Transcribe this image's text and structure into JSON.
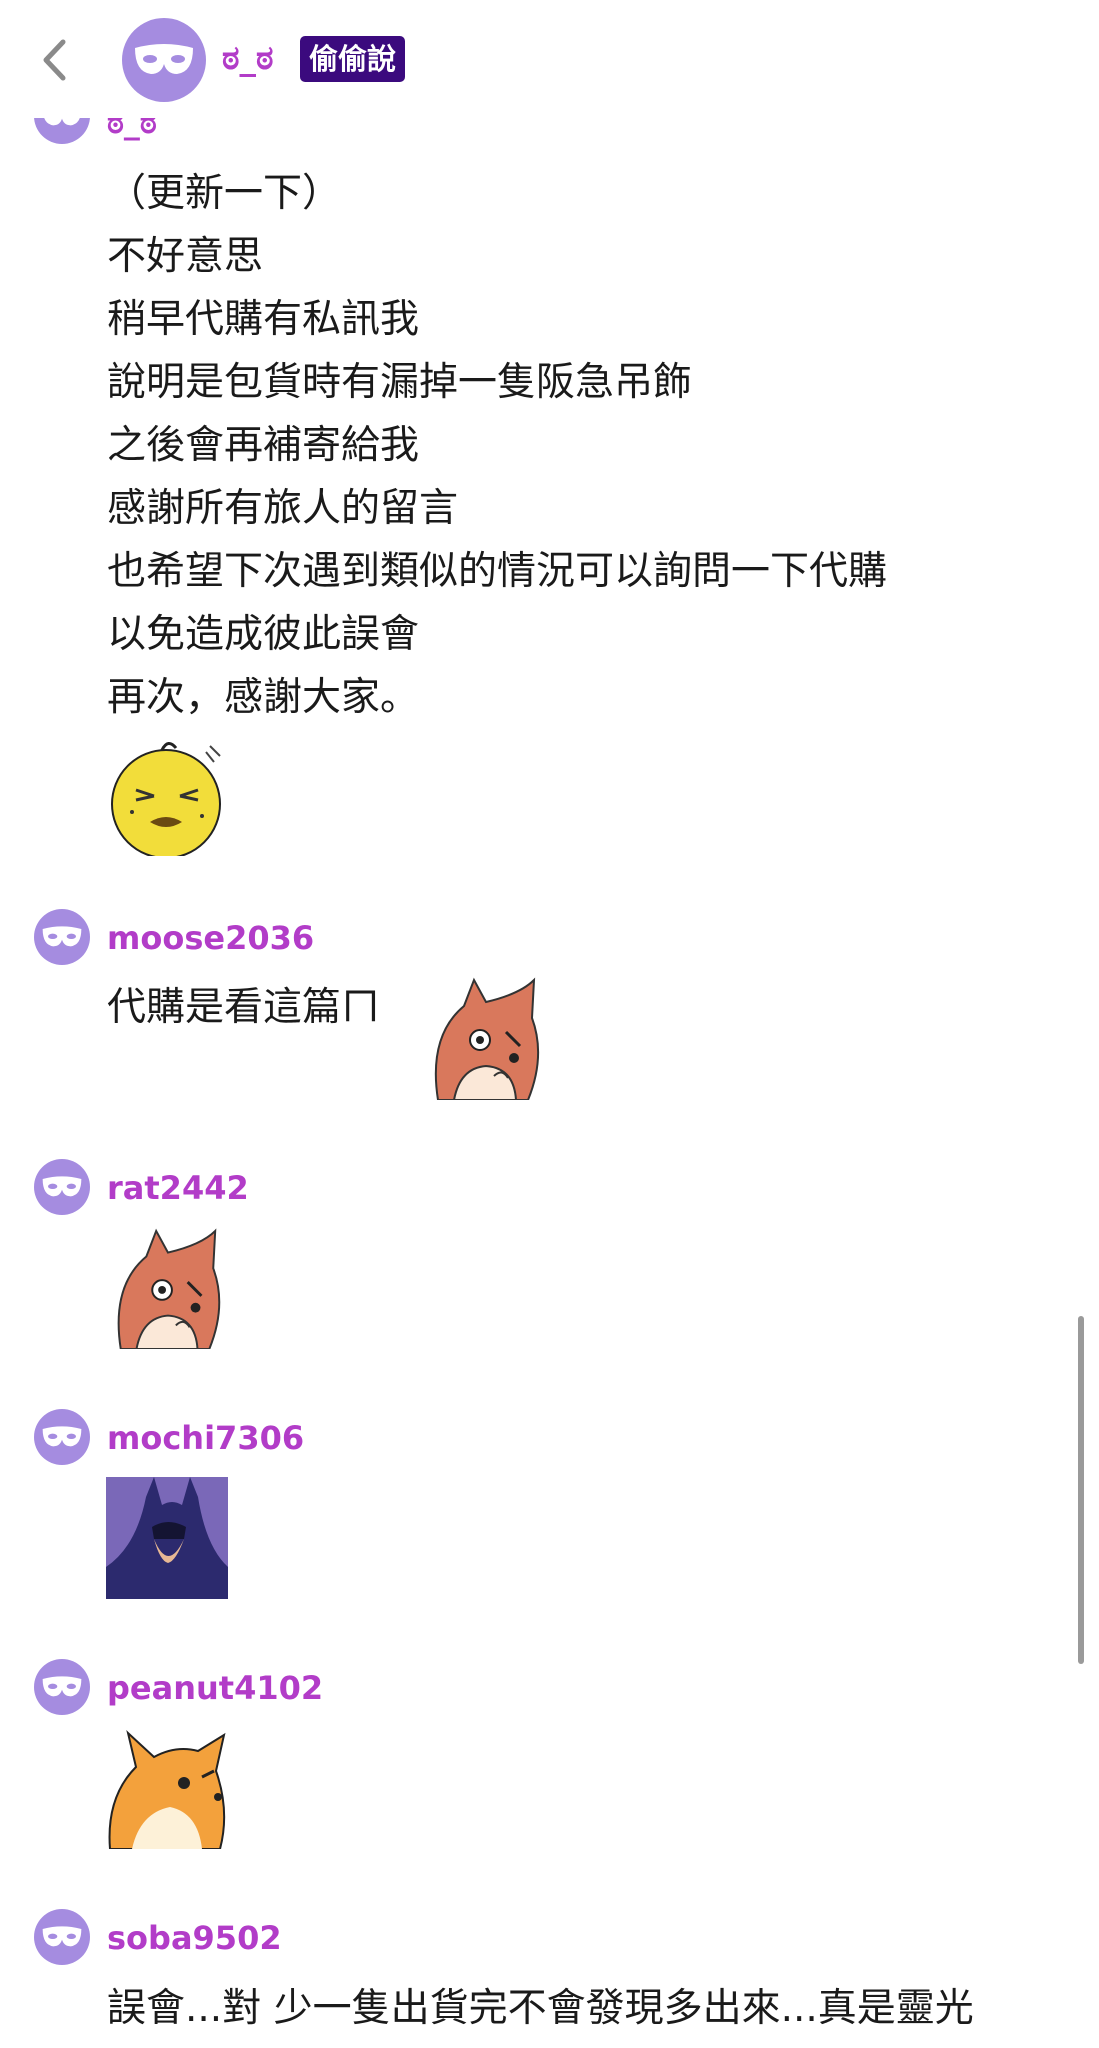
{
  "header": {
    "name": "ಠ_ಠ",
    "badge": "偷偷說"
  },
  "comments": [
    {
      "username": "ಠ_ಠ",
      "lines": [
        "（更新一下）",
        "不好意思",
        "稍早代購有私訊我",
        "說明是包貨時有漏掉一隻阪急吊飾",
        "之後會再補寄給我",
        "感謝所有旅人的留言",
        "也希望下次遇到類似的情況可以詢問一下代購",
        "以免造成彼此誤會",
        "再次，感謝大家。"
      ],
      "sticker": "yellow-chick-sticker"
    },
    {
      "username": "moose2036",
      "lines": [
        "代購是看這篇ㄇ"
      ],
      "sticker": "fox-thinking-sticker"
    },
    {
      "username": "rat2442",
      "lines": [],
      "sticker": "fox-thinking-sticker"
    },
    {
      "username": "mochi7306",
      "lines": [],
      "sticker": "batman-thinking-sticker"
    },
    {
      "username": "peanut4102",
      "lines": [],
      "sticker": "shiba-side-eye-sticker"
    },
    {
      "username": "soba9502",
      "lines": [
        "誤會...對 少一隻出貨完不會發現多出來...真是靈光"
      ]
    }
  ],
  "colors": {
    "accent": "#b23cc8",
    "badge_bg": "#3b0a7e",
    "avatar_bg": "#a58ce0"
  }
}
